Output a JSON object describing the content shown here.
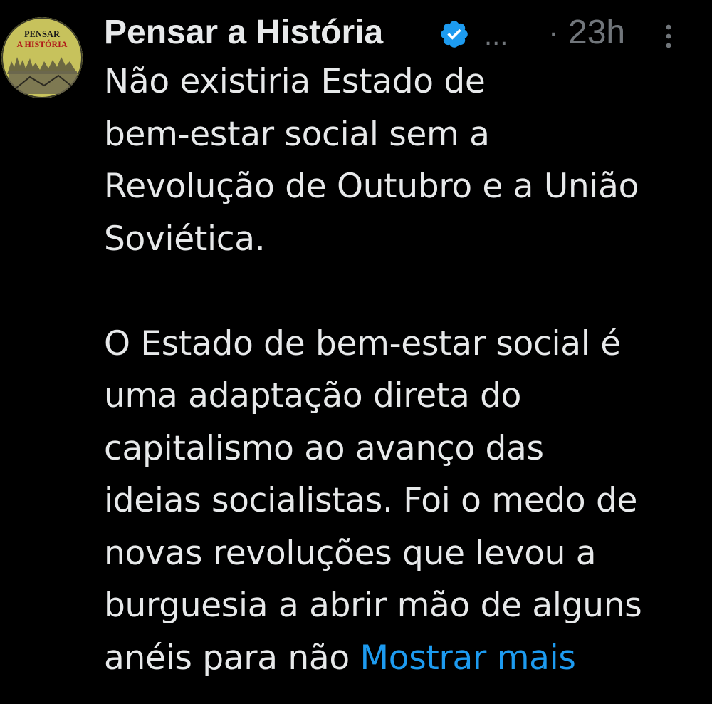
{
  "tweet": {
    "avatar_text_top": "PENSAR",
    "avatar_text_bottom": "A HISTÓRIA",
    "display_name": "Pensar a História",
    "handle_ellipsis": "...",
    "separator": "·",
    "timestamp": "23h",
    "paragraph1": [
      "Não existiria Estado de",
      "bem-estar social sem a",
      "Revolução de Outubro e a União",
      "Soviética."
    ],
    "paragraph2": [
      "O Estado de bem-estar social é",
      "uma adaptação direta do",
      "capitalismo ao avanço das",
      "ideias socialistas. Foi o medo de",
      "novas revoluções que levou a",
      "burguesia a abrir mão de alguns"
    ],
    "last_line_text": "anéis para não",
    "show_more": "Mostrar mais"
  },
  "colors": {
    "background": "#000000",
    "text": "#e7e9ea",
    "secondary": "#71767b",
    "link": "#1d9bf0",
    "verified": "#1d9bf0"
  },
  "icons": {
    "verified": "verified-badge-icon",
    "more": "more-options-icon"
  }
}
